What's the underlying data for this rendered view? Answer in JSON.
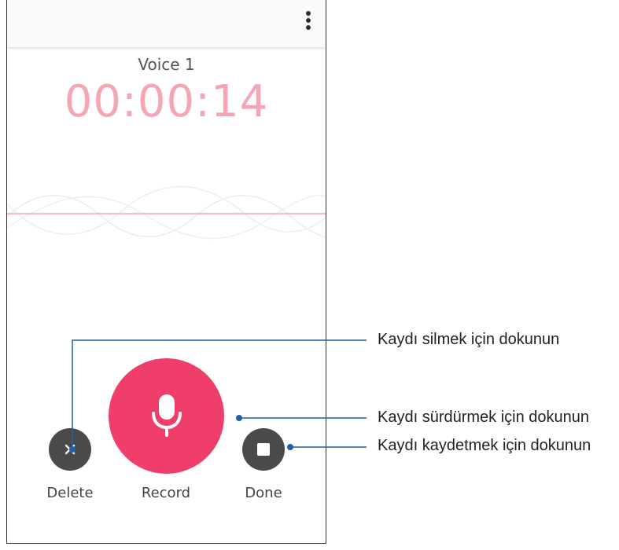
{
  "recording": {
    "title": "Voice 1",
    "elapsed": "00:00:14"
  },
  "controls": {
    "delete_label": "Delete",
    "record_label": "Record",
    "done_label": "Done"
  },
  "annotations": {
    "delete": "Kaydı silmek için dokunun",
    "record": "Kaydı sürdürmek için dokunun",
    "done": "Kaydı kaydetmek için dokunun"
  },
  "icons": {
    "menu": "overflow-menu-icon",
    "delete": "close-icon",
    "record": "microphone-icon",
    "done": "stop-icon"
  },
  "colors": {
    "accent": "#f03e6a",
    "timer": "#f4a6b4",
    "button_dark": "#4a4a4a",
    "callout_line": "#1f5fa8"
  }
}
